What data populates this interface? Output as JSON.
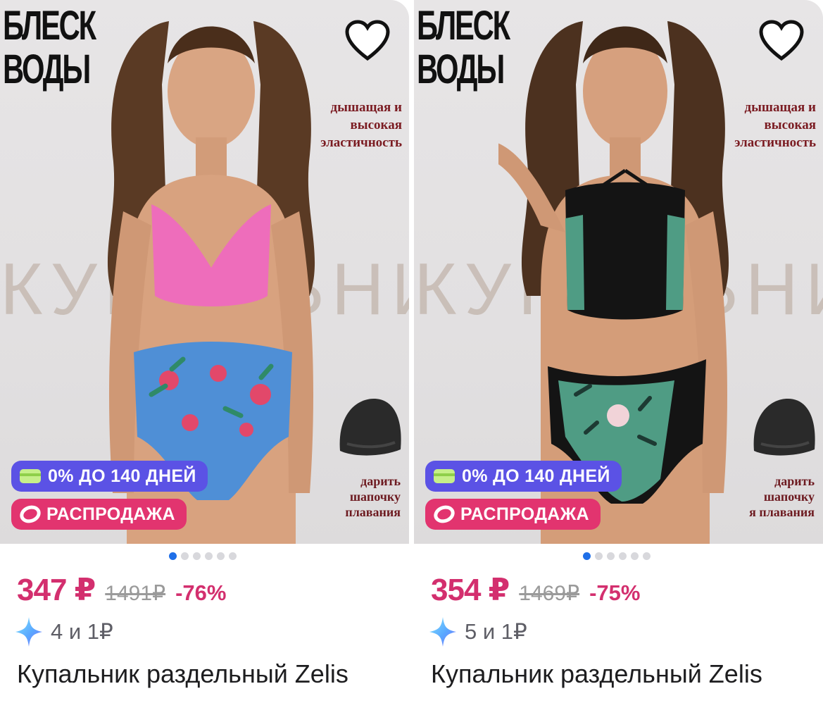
{
  "products": [
    {
      "brand": [
        "БЛЕСК",
        "ВОДЫ"
      ],
      "feature_text": [
        "дышащая и",
        "высокая",
        "эластичность"
      ],
      "watermark": "КУПАЛЬНИК",
      "gift_text": [
        "дарить",
        "шапочку",
        "плавания"
      ],
      "badges": {
        "credit": "0% ДО 140 ДНЕЙ",
        "sale": "РАСПРОДАЖА"
      },
      "price": "347 ₽",
      "old_price": "1491₽",
      "discount": "-76%",
      "bonus": "4 и 1₽",
      "title": "Купальник раздельный Zelis",
      "carousel": {
        "count": 6,
        "active": 0
      },
      "colors": {
        "top": "#ee6dbb",
        "bottom": "#4f8fd6",
        "flower": "#e2486a",
        "leaf": "#2f8a68"
      }
    },
    {
      "brand": [
        "БЛЕСК",
        "ВОДЫ"
      ],
      "feature_text": [
        "дышащая и",
        "высокая",
        "эластичность"
      ],
      "watermark": "КУПАЛЬНИК",
      "gift_text": [
        "дарить",
        "шапочку",
        "я плавания"
      ],
      "badges": {
        "credit": "0% ДО 140 ДНЕЙ",
        "sale": "РАСПРОДАЖА"
      },
      "price": "354 ₽",
      "old_price": "1469₽",
      "discount": "-75%",
      "bonus": "5 и 1₽",
      "title": "Купальник раздельный Zelis",
      "carousel": {
        "count": 6,
        "active": 0
      },
      "colors": {
        "top": "#141414",
        "bottom": "#141414",
        "flower": "#f1d3d8",
        "leaf": "#4f9c84"
      }
    }
  ],
  "icons": {
    "favorite": "heart-outline-icon",
    "installment": "credit-card-icon",
    "sale": "sale-ring-icon",
    "bonus": "sparkle-icon"
  },
  "accent": "#d32f6e",
  "credit_badge_color": "#5b52e5",
  "sale_badge_color": "#e2346f",
  "active_dot_color": "#1f6fe8"
}
